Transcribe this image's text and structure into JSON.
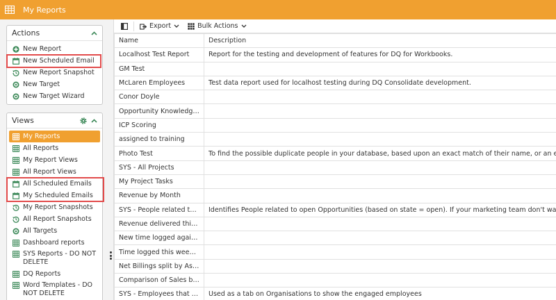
{
  "header": {
    "title": "My Reports"
  },
  "actions": {
    "title": "Actions",
    "items": [
      {
        "label": "New Report",
        "icon": "plus-circle-icon"
      },
      {
        "label": "New Scheduled Email",
        "icon": "calendar-icon"
      },
      {
        "label": "New Report Snapshot",
        "icon": "history-icon"
      },
      {
        "label": "New Target",
        "icon": "target-icon"
      },
      {
        "label": "New Target Wizard",
        "icon": "target-icon"
      }
    ]
  },
  "views": {
    "title": "Views",
    "items": [
      {
        "label": "My Reports",
        "icon": "grid-icon"
      },
      {
        "label": "All Reports",
        "icon": "grid-icon"
      },
      {
        "label": "My Report Views",
        "icon": "grid-icon"
      },
      {
        "label": "All Report Views",
        "icon": "grid-icon"
      },
      {
        "label": "All Scheduled Emails",
        "icon": "calendar-icon"
      },
      {
        "label": "My Scheduled Emails",
        "icon": "calendar-icon"
      },
      {
        "label": "My Report Snapshots",
        "icon": "history-icon"
      },
      {
        "label": "All Report Snapshots",
        "icon": "history-icon"
      },
      {
        "label": "All Targets",
        "icon": "target-icon"
      },
      {
        "label": "Dashboard reports",
        "icon": "grid-icon"
      },
      {
        "label": "SYS Reports - DO NOT DELETE",
        "icon": "grid-icon"
      },
      {
        "label": "DQ Reports",
        "icon": "grid-icon"
      },
      {
        "label": "Word Templates - DO NOT DELETE",
        "icon": "grid-icon"
      }
    ]
  },
  "toolbar": {
    "export_label": "Export",
    "bulk_label": "Bulk Actions"
  },
  "table": {
    "headers": [
      "Name",
      "Description"
    ],
    "rows": [
      [
        "Localhost Test Report",
        "Report for the testing and development of features for DQ for Workbooks."
      ],
      [
        "GM Test",
        ""
      ],
      [
        "McLaren Employees",
        "Test data report used for localhost testing during DQ Consolidate development."
      ],
      [
        "Conor Doyle",
        ""
      ],
      [
        "Opportunity Knowledge ...",
        ""
      ],
      [
        "ICP Scoring",
        ""
      ],
      [
        "assigned to training",
        ""
      ],
      [
        "Photo Test",
        "To find the possible duplicate people in your database, based upon an exact match of their name, or an exact mat"
      ],
      [
        "SYS - All Projects",
        ""
      ],
      [
        "My Project Tasks",
        ""
      ],
      [
        "Revenue by Month",
        ""
      ],
      [
        "SYS - People related to ...",
        "Identifies People related to open Opportunities (based on state = open). If your marketing team don't want to acti"
      ],
      [
        "Revenue delivered this p...",
        ""
      ],
      [
        "New time logged against...",
        ""
      ],
      [
        "Time logged this week a...",
        ""
      ],
      [
        "Net Billings split by Assi...",
        ""
      ],
      [
        "Comparison of Sales by ...",
        ""
      ],
      [
        "SYS - Employees that ha...",
        "Used as a tab on Organisations to show the engaged employees"
      ]
    ]
  },
  "colors": {
    "accent": "#f0a030",
    "highlight": "#e24a4a",
    "icon_green": "#3e8a5a"
  }
}
